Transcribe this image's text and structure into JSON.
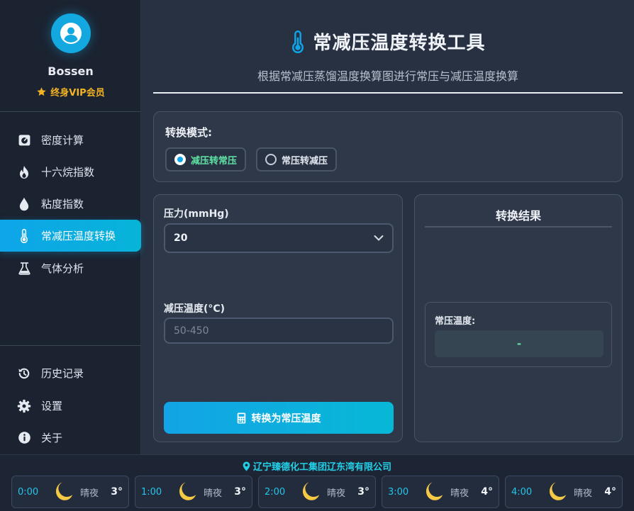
{
  "user": {
    "name": "Bossen",
    "membership": "终身VIP会员"
  },
  "nav": [
    {
      "label": "密度计算",
      "icon": "gauge-icon"
    },
    {
      "label": "十六烷指数",
      "icon": "fire-icon"
    },
    {
      "label": "粘度指数",
      "icon": "droplet-icon"
    },
    {
      "label": "常减压温度转换",
      "icon": "thermometer-icon",
      "active": true
    },
    {
      "label": "气体分析",
      "icon": "flask-icon"
    }
  ],
  "nav_bottom": [
    {
      "label": "历史记录",
      "icon": "history-icon"
    },
    {
      "label": "设置",
      "icon": "gear-icon"
    },
    {
      "label": "关于",
      "icon": "info-icon"
    }
  ],
  "page": {
    "title": "常减压温度转换工具",
    "subtitle": "根据常减压蒸馏温度换算图进行常压与减压温度换算"
  },
  "mode": {
    "label": "转换模式:",
    "options": [
      "减压转常压",
      "常压转减压"
    ],
    "selected": "减压转常压"
  },
  "form": {
    "pressure_label": "压力(mmHg)",
    "pressure_value": "20",
    "temp_label": "减压温度(°C)",
    "temp_placeholder": "50-450",
    "convert_button": "转换为常压温度"
  },
  "result": {
    "title": "转换结果",
    "label": "常压温度:",
    "value": "-"
  },
  "footer": {
    "company": "辽宁臻德化工集团辽东湾有限公司",
    "weather": [
      {
        "time": "0:00",
        "condition": "晴夜",
        "temp": "3°",
        "icon": "moon-icon"
      },
      {
        "time": "1:00",
        "condition": "晴夜",
        "temp": "3°",
        "icon": "moon-icon"
      },
      {
        "time": "2:00",
        "condition": "晴夜",
        "temp": "3°",
        "icon": "moon-icon"
      },
      {
        "time": "3:00",
        "condition": "晴夜",
        "temp": "4°",
        "icon": "moon-icon"
      },
      {
        "time": "4:00",
        "condition": "晴夜",
        "temp": "4°",
        "icon": "moon-icon"
      }
    ]
  },
  "colors": {
    "accent": "#0ea5e9",
    "vip_gold": "#f4b323",
    "result_green": "#5fe3a4",
    "company_cyan": "#22d0e8"
  }
}
